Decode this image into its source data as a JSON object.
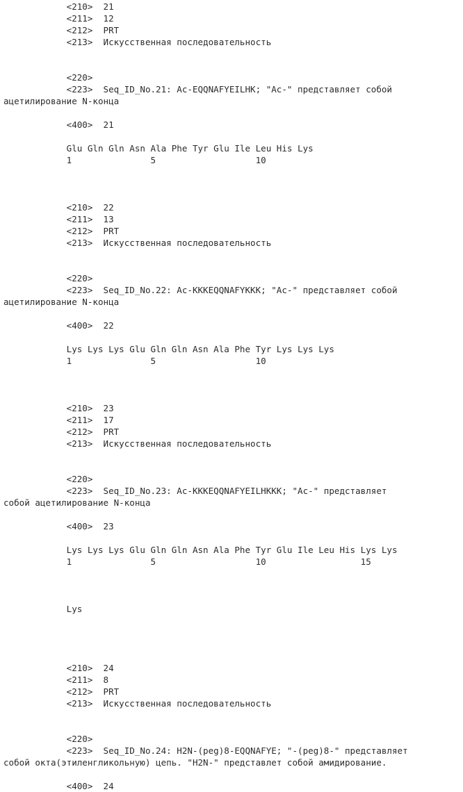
{
  "document": {
    "type": "patent-sequence-listing",
    "language": "ru",
    "page_background": "#ffffff",
    "text_color": "#2b2b2b",
    "font_style": "monospace",
    "indent_spaces": 12,
    "labels": {
      "seq_id_tag": "<210>",
      "length_tag": "<211>",
      "type_tag": "<212>",
      "organism_tag": "<213>",
      "feature_tag": "<220>",
      "other_info_tag": "<223>",
      "sequence_tag": "<400>",
      "organism_value": "Искусственная последовательность",
      "molecule_type": "PRT"
    }
  },
  "lines": [
    {
      "id": "l001",
      "text": "            <210>  21"
    },
    {
      "id": "l002",
      "text": "            <211>  12"
    },
    {
      "id": "l003",
      "text": "            <212>  PRT"
    },
    {
      "id": "l004",
      "text": "            <213>  Искусственная последовательность"
    },
    {
      "id": "l005",
      "text": ""
    },
    {
      "id": "l006",
      "text": ""
    },
    {
      "id": "l007",
      "text": "            <220>"
    },
    {
      "id": "l008",
      "text": "            <223>  Seq_ID_No.21: Ac-EQQNAFYEILHK; \"Ac-\" представляет собой"
    },
    {
      "id": "l009",
      "text": "ацетилирование N-конца"
    },
    {
      "id": "l010",
      "text": ""
    },
    {
      "id": "l011",
      "text": "            <400>  21"
    },
    {
      "id": "l012",
      "text": ""
    },
    {
      "id": "l013",
      "text": "            Glu Gln Gln Asn Ala Phe Tyr Glu Ile Leu His Lys"
    },
    {
      "id": "l014",
      "text": "            1               5                   10"
    },
    {
      "id": "l015",
      "text": ""
    },
    {
      "id": "l016",
      "text": ""
    },
    {
      "id": "l017",
      "text": ""
    },
    {
      "id": "l018",
      "text": "            <210>  22"
    },
    {
      "id": "l019",
      "text": "            <211>  13"
    },
    {
      "id": "l020",
      "text": "            <212>  PRT"
    },
    {
      "id": "l021",
      "text": "            <213>  Искусственная последовательность"
    },
    {
      "id": "l022",
      "text": ""
    },
    {
      "id": "l023",
      "text": ""
    },
    {
      "id": "l024",
      "text": "            <220>"
    },
    {
      "id": "l025",
      "text": "            <223>  Seq_ID_No.22: Ac-KKKEQQNAFYKKK; \"Ac-\" представляет собой"
    },
    {
      "id": "l026",
      "text": "ацетилирование N-конца"
    },
    {
      "id": "l027",
      "text": ""
    },
    {
      "id": "l028",
      "text": "            <400>  22"
    },
    {
      "id": "l029",
      "text": ""
    },
    {
      "id": "l030",
      "text": "            Lys Lys Lys Glu Gln Gln Asn Ala Phe Tyr Lys Lys Lys"
    },
    {
      "id": "l031",
      "text": "            1               5                   10"
    },
    {
      "id": "l032",
      "text": ""
    },
    {
      "id": "l033",
      "text": ""
    },
    {
      "id": "l034",
      "text": ""
    },
    {
      "id": "l035",
      "text": "            <210>  23"
    },
    {
      "id": "l036",
      "text": "            <211>  17"
    },
    {
      "id": "l037",
      "text": "            <212>  PRT"
    },
    {
      "id": "l038",
      "text": "            <213>  Искусственная последовательность"
    },
    {
      "id": "l039",
      "text": ""
    },
    {
      "id": "l040",
      "text": ""
    },
    {
      "id": "l041",
      "text": "            <220>"
    },
    {
      "id": "l042",
      "text": "            <223>  Seq_ID_No.23: Ac-KKKEQQNAFYEILHKKK; \"Ac-\" представляет"
    },
    {
      "id": "l043",
      "text": "собой ацетилирование N-конца"
    },
    {
      "id": "l044",
      "text": ""
    },
    {
      "id": "l045",
      "text": "            <400>  23"
    },
    {
      "id": "l046",
      "text": ""
    },
    {
      "id": "l047",
      "text": "            Lys Lys Lys Glu Gln Gln Asn Ala Phe Tyr Glu Ile Leu His Lys Lys"
    },
    {
      "id": "l048",
      "text": "            1               5                   10                  15"
    },
    {
      "id": "l049",
      "text": ""
    },
    {
      "id": "l050",
      "text": ""
    },
    {
      "id": "l051",
      "text": ""
    },
    {
      "id": "l052",
      "text": "            Lys"
    },
    {
      "id": "l053",
      "text": ""
    },
    {
      "id": "l054",
      "text": ""
    },
    {
      "id": "l055",
      "text": ""
    },
    {
      "id": "l056",
      "text": ""
    },
    {
      "id": "l057",
      "text": "            <210>  24"
    },
    {
      "id": "l058",
      "text": "            <211>  8"
    },
    {
      "id": "l059",
      "text": "            <212>  PRT"
    },
    {
      "id": "l060",
      "text": "            <213>  Искусственная последовательность"
    },
    {
      "id": "l061",
      "text": ""
    },
    {
      "id": "l062",
      "text": ""
    },
    {
      "id": "l063",
      "text": "            <220>"
    },
    {
      "id": "l064",
      "text": "            <223>  Seq_ID_No.24: H2N-(peg)8-EQQNAFYE; \"-(peg)8-\" представляет"
    },
    {
      "id": "l065",
      "text": "собой окта(этиленгликольную) цепь. \"H2N-\" представлет собой амидирование."
    },
    {
      "id": "l066",
      "text": ""
    },
    {
      "id": "l067",
      "text": "            <400>  24"
    }
  ],
  "sequences": [
    {
      "seq_id": "21",
      "length": "12",
      "mol_type": "PRT",
      "organism": "Искусственная последовательность",
      "other_info": "Seq_ID_No.21: Ac-EQQNAFYEILHK; \"Ac-\" представляет собой ацетилирование N-конца",
      "residues": [
        "Glu",
        "Gln",
        "Gln",
        "Asn",
        "Ala",
        "Phe",
        "Tyr",
        "Glu",
        "Ile",
        "Leu",
        "His",
        "Lys"
      ],
      "position_markers": [
        "1",
        "5",
        "10"
      ]
    },
    {
      "seq_id": "22",
      "length": "13",
      "mol_type": "PRT",
      "organism": "Искусственная последовательность",
      "other_info": "Seq_ID_No.22: Ac-KKKEQQNAFYKKK; \"Ac-\" представляет собой ацетилирование N-конца",
      "residues": [
        "Lys",
        "Lys",
        "Lys",
        "Glu",
        "Gln",
        "Gln",
        "Asn",
        "Ala",
        "Phe",
        "Tyr",
        "Lys",
        "Lys",
        "Lys"
      ],
      "position_markers": [
        "1",
        "5",
        "10"
      ]
    },
    {
      "seq_id": "23",
      "length": "17",
      "mol_type": "PRT",
      "organism": "Искусственная последовательность",
      "other_info": "Seq_ID_No.23: Ac-KKKEQQNAFYEILHKKK; \"Ac-\" представляет собой ацетилирование N-конца",
      "residues": [
        "Lys",
        "Lys",
        "Lys",
        "Glu",
        "Gln",
        "Gln",
        "Asn",
        "Ala",
        "Phe",
        "Tyr",
        "Glu",
        "Ile",
        "Leu",
        "His",
        "Lys",
        "Lys",
        "Lys"
      ],
      "position_markers": [
        "1",
        "5",
        "10",
        "15"
      ]
    },
    {
      "seq_id": "24",
      "length": "8",
      "mol_type": "PRT",
      "organism": "Искусственная последовательность",
      "other_info": "Seq_ID_No.24: H2N-(peg)8-EQQNAFYE; \"-(peg)8-\" представляет собой окта(этиленгликольную) цепь. \"H2N-\" представлет собой амидирование.",
      "residues": [],
      "position_markers": []
    }
  ]
}
